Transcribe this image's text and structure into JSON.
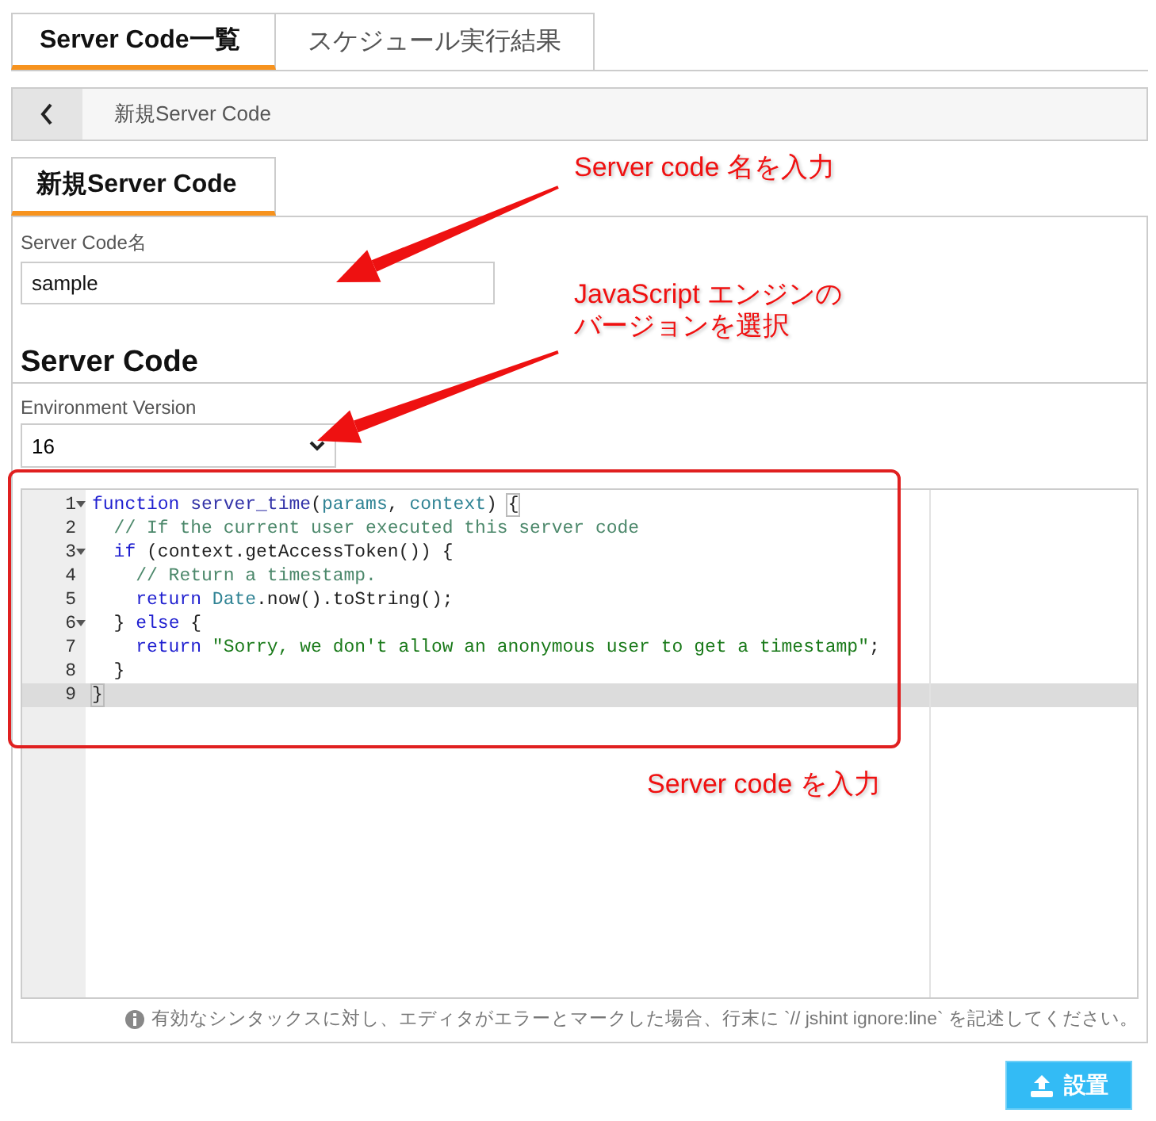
{
  "tabs": [
    {
      "label": "Server Code一覧",
      "selected": true
    },
    {
      "label": "スケジュール実行結果",
      "selected": false
    }
  ],
  "breadcrumb": {
    "title": "新規Server Code"
  },
  "subtab": {
    "label": "新規Server Code",
    "selected": true
  },
  "name_field": {
    "label": "Server Code名",
    "value": "sample"
  },
  "section_title": "Server Code",
  "version_field": {
    "label": "Environment Version",
    "value": "16"
  },
  "editor": {
    "lines": [
      {
        "number": "1",
        "foldable": true,
        "active": false,
        "tokens": [
          {
            "kind": "keyword",
            "text": "function"
          },
          {
            "kind": "name",
            "text": " server_time"
          },
          {
            "kind": "plain",
            "text": "("
          },
          {
            "kind": "param",
            "text": "params"
          },
          {
            "kind": "plain",
            "text": ", "
          },
          {
            "kind": "param",
            "text": "context"
          },
          {
            "kind": "plain",
            "text": ") "
          },
          {
            "kind": "bracket",
            "text": "{"
          }
        ]
      },
      {
        "number": "2",
        "foldable": false,
        "active": false,
        "tokens": [
          {
            "kind": "comment",
            "text": "  // If the current user executed this server code"
          }
        ]
      },
      {
        "number": "3",
        "foldable": true,
        "active": false,
        "tokens": [
          {
            "kind": "keyword",
            "text": "  if"
          },
          {
            "kind": "plain",
            "text": " (context.getAccessToken()) {"
          }
        ]
      },
      {
        "number": "4",
        "foldable": false,
        "active": false,
        "tokens": [
          {
            "kind": "comment",
            "text": "    // Return a timestamp."
          }
        ]
      },
      {
        "number": "5",
        "foldable": false,
        "active": false,
        "tokens": [
          {
            "kind": "keyword",
            "text": "    return"
          },
          {
            "kind": "param",
            "text": " Date"
          },
          {
            "kind": "plain",
            "text": ".now().toString();"
          }
        ]
      },
      {
        "number": "6",
        "foldable": true,
        "active": false,
        "tokens": [
          {
            "kind": "plain",
            "text": "  } "
          },
          {
            "kind": "keyword",
            "text": "else"
          },
          {
            "kind": "plain",
            "text": " {"
          }
        ]
      },
      {
        "number": "7",
        "foldable": false,
        "active": false,
        "tokens": [
          {
            "kind": "keyword",
            "text": "    return"
          },
          {
            "kind": "string",
            "text": " \"Sorry, we don't allow an anonymous user to get a timestamp\""
          },
          {
            "kind": "plain",
            "text": ";"
          }
        ]
      },
      {
        "number": "8",
        "foldable": false,
        "active": false,
        "tokens": [
          {
            "kind": "plain",
            "text": "  }"
          }
        ]
      },
      {
        "number": "9",
        "foldable": false,
        "active": true,
        "tokens": [
          {
            "kind": "bracket",
            "text": "}"
          }
        ]
      }
    ]
  },
  "hint": "有効なシンタックスに対し、エディタがエラーとマークした場合、行末に `// jshint ignore:line` を記述してください。",
  "submit_button": "設置",
  "annotations": [
    {
      "kind": "arrow",
      "lines": [
        "Server code 名を入力"
      ]
    },
    {
      "kind": "arrow",
      "lines": [
        "JavaScript エンジンの",
        "バージョンを選択"
      ]
    },
    {
      "kind": "frame",
      "lines": [
        "Server code を入力"
      ]
    }
  ]
}
